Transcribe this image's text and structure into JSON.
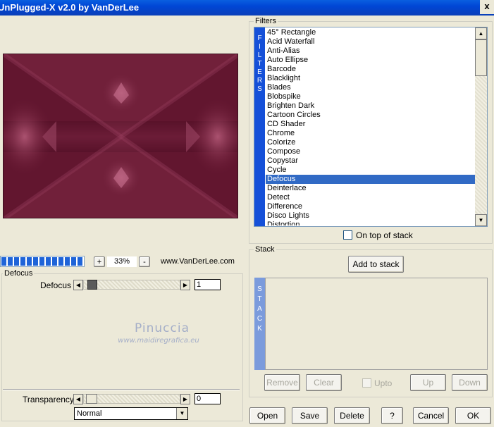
{
  "window": {
    "title": "UnPlugged-X v2.0 by VanDerLee",
    "close_glyph": "x"
  },
  "filters": {
    "group_label": "Filters",
    "strip_letters": [
      "F",
      "I",
      "L",
      "T",
      "E",
      "R",
      "S"
    ],
    "items": [
      "45° Rectangle",
      "Acid Waterfall",
      "Anti-Alias",
      "Auto Ellipse",
      "Barcode",
      "Blacklight",
      "Blades",
      "Blobspike",
      "Brighten Dark",
      "Cartoon Circles",
      "CD Shader",
      "Chrome",
      "Colorize",
      "Compose",
      "Copystar",
      "Cycle",
      "Defocus",
      "Deinterlace",
      "Detect",
      "Difference",
      "Disco Lights",
      "Distortion"
    ],
    "selected": "Defocus",
    "on_top_label": "On top of stack"
  },
  "preview": {
    "zoom_value": "33%",
    "plus_label": "+",
    "minus_label": "-",
    "website": "www.VanDerLee.com",
    "colors": {
      "base": "#6a1a34",
      "light": "#a04a68",
      "dark": "#4a0d22"
    }
  },
  "params": {
    "group_label": "Defocus",
    "defocus_label": "Defocus",
    "defocus_value": "1",
    "transparency_label": "Transparency",
    "transparency_value": "0",
    "blend_mode": "Normal"
  },
  "watermark": {
    "title": "Pinuccia",
    "url": "www.maidiregrafica.eu"
  },
  "stack": {
    "group_label": "Stack",
    "add_label": "Add to stack",
    "strip_letters": [
      "S",
      "T",
      "A",
      "C",
      "K"
    ],
    "remove_label": "Remove",
    "clear_label": "Clear",
    "upto_label": "Upto",
    "up_label": "Up",
    "down_label": "Down"
  },
  "footer": {
    "open_label": "Open",
    "save_label": "Save",
    "delete_label": "Delete",
    "help_label": "?",
    "cancel_label": "Cancel",
    "ok_label": "OK"
  },
  "icons": [
    "scroll-up-icon",
    "scroll-down-icon",
    "arrow-left-icon",
    "arrow-right-icon",
    "dropdown-icon"
  ]
}
